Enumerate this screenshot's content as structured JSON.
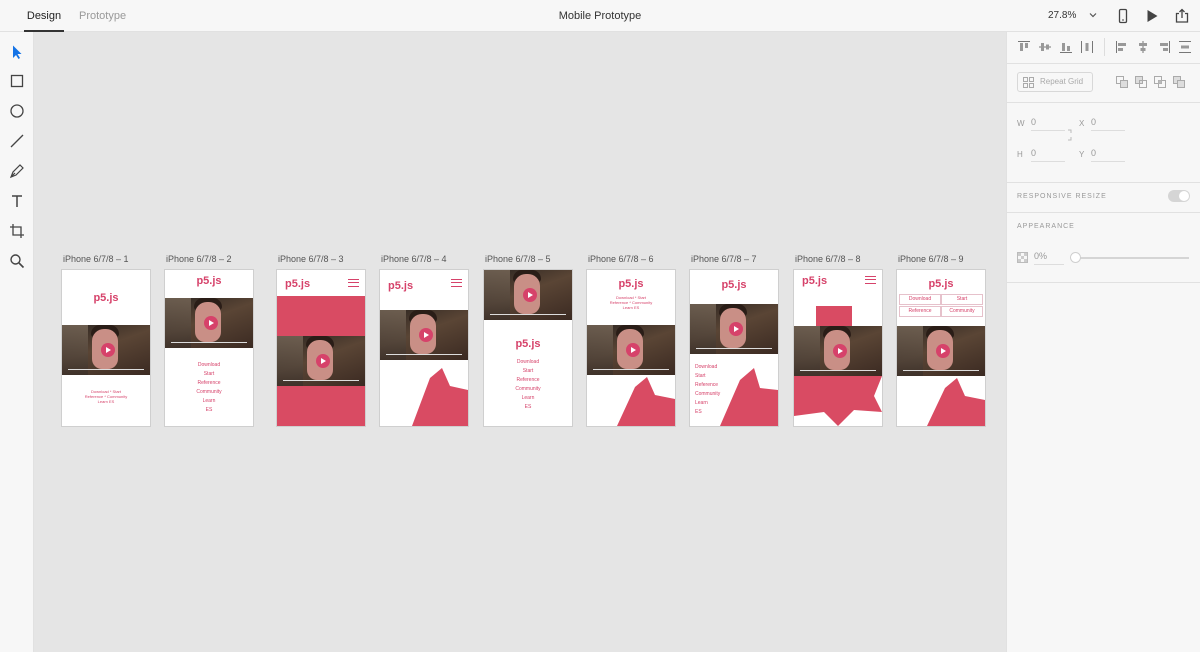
{
  "topbar": {
    "tabs": [
      {
        "label": "Design",
        "active": true
      },
      {
        "label": "Prototype",
        "active": false
      }
    ],
    "title": "Mobile Prototype",
    "zoom": "27.8%",
    "icons": [
      "device-preview-icon",
      "play-icon",
      "share-icon"
    ]
  },
  "tools": [
    "select-icon",
    "rectangle-icon",
    "ellipse-icon",
    "line-icon",
    "pen-icon",
    "text-icon",
    "artboard-icon",
    "zoom-icon"
  ],
  "canvas": {
    "brand_color": "#d6426a",
    "artboards": [
      {
        "label": "iPhone 6/7/8 – 1",
        "logo": "p5.js",
        "menu": "Download * Start\nReference * Community\nLearn ES"
      },
      {
        "label": "iPhone 6/7/8 – 2",
        "logo": "p5.js",
        "menu": "Download\nStart\nReference\nCommunity\nLearn\nES"
      },
      {
        "label": "iPhone 6/7/8 – 3",
        "logo": "p5.js"
      },
      {
        "label": "iPhone 6/7/8 – 4",
        "logo": "p5.js"
      },
      {
        "label": "iPhone 6/7/8 – 5",
        "logo": "p5.js",
        "menu": "Download\nStart\nReference\nCommunity\nLearn\nES"
      },
      {
        "label": "iPhone 6/7/8 – 6",
        "logo": "p5.js",
        "menu": "Download * Start\nReference * Community\nLearn ES"
      },
      {
        "label": "iPhone 6/7/8 – 7",
        "logo": "p5.js",
        "menu": "Download\nStart\nReference\nCommunity\nLearn\nES"
      },
      {
        "label": "iPhone 6/7/8 – 8",
        "logo": "p5.js"
      },
      {
        "label": "iPhone 6/7/8 – 9",
        "logo": "p5.js",
        "grid": [
          "Download",
          "Start",
          "Reference",
          "Community"
        ]
      }
    ]
  },
  "properties": {
    "repeat_grid": "Repeat Grid",
    "w_label": "W",
    "w_value": "0",
    "h_label": "H",
    "h_value": "0",
    "x_label": "X",
    "x_value": "0",
    "y_label": "Y",
    "y_value": "0",
    "responsive_resize": "RESPONSIVE RESIZE",
    "appearance": "APPEARANCE",
    "opacity": "0%"
  }
}
